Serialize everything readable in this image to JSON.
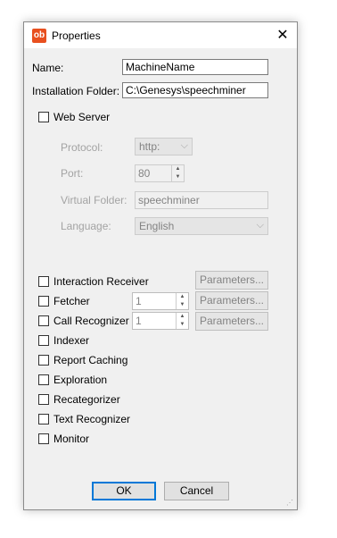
{
  "window": {
    "title": "Properties",
    "app_icon_text": "ob"
  },
  "form": {
    "name_label": "Name:",
    "name_value": "MachineName",
    "install_label": "Installation Folder:",
    "install_value": "C:\\Genesys\\speechminer"
  },
  "web_server": {
    "label": "Web Server",
    "protocol_label": "Protocol:",
    "protocol_value": "http:",
    "port_label": "Port:",
    "port_value": "80",
    "vfolder_label": "Virtual Folder:",
    "vfolder_value": "speechminer",
    "language_label": "Language:",
    "language_value": "English"
  },
  "components": [
    {
      "label": "Interaction Receiver",
      "params": "Parameters..."
    },
    {
      "label": "Fetcher",
      "spin": "1",
      "params": "Parameters..."
    },
    {
      "label": "Call Recognizer",
      "spin": "1",
      "params": "Parameters..."
    },
    {
      "label": "Indexer"
    },
    {
      "label": "Report Caching"
    },
    {
      "label": "Exploration"
    },
    {
      "label": "Recategorizer"
    },
    {
      "label": "Text Recognizer"
    },
    {
      "label": "Monitor"
    }
  ],
  "buttons": {
    "ok": "OK",
    "cancel": "Cancel"
  },
  "colors": {
    "accent": "#0078d7",
    "app_icon": "#e8501f"
  }
}
